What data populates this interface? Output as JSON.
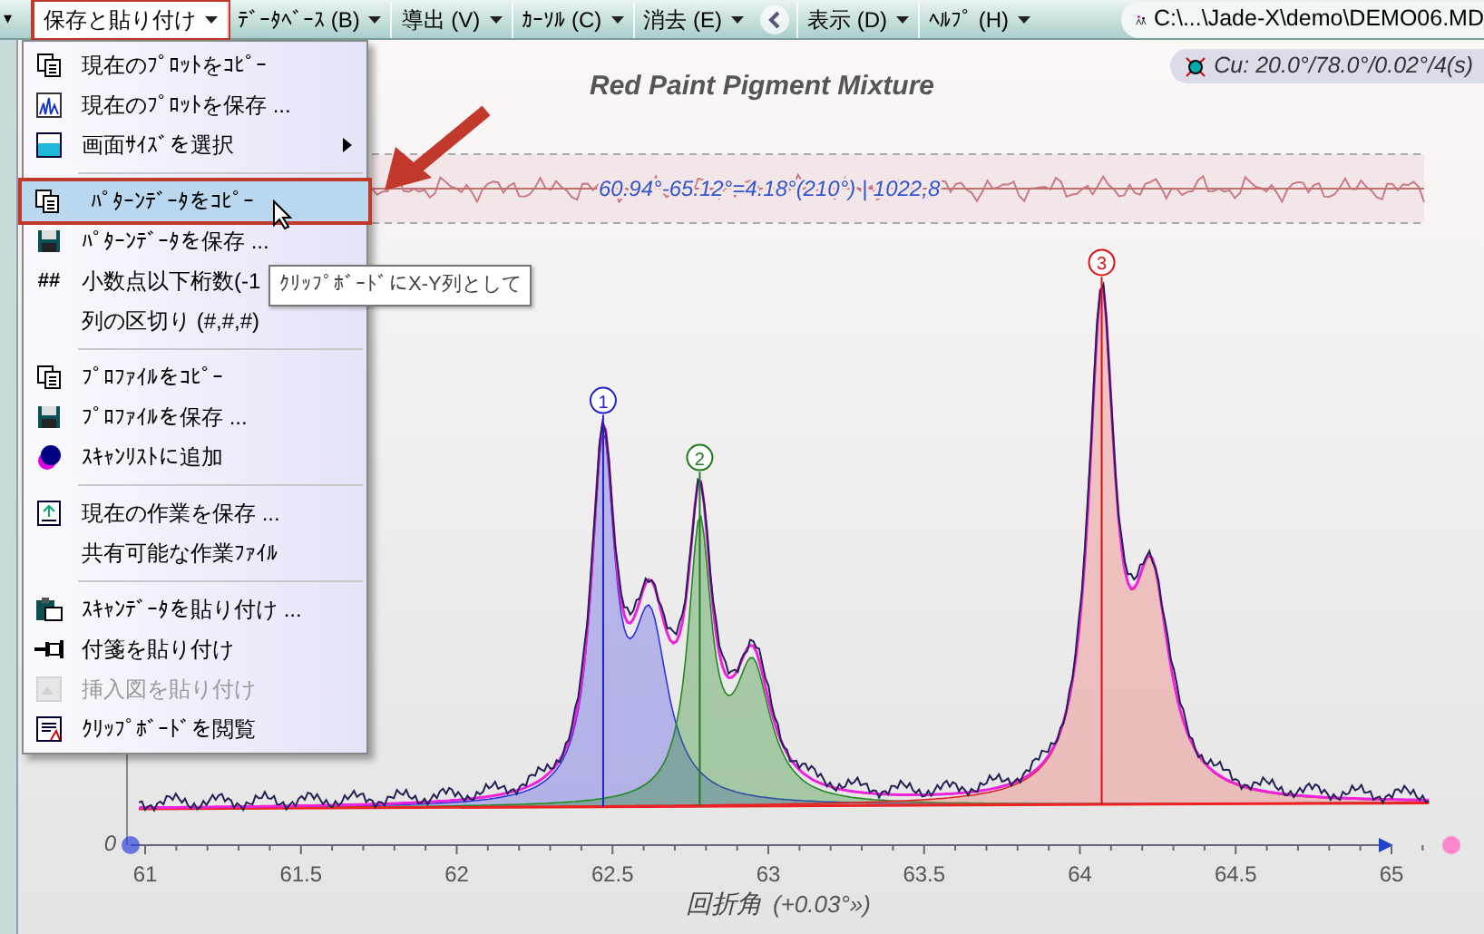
{
  "toolbar": {
    "lead_caret": "▾",
    "items": [
      {
        "label": "保存と貼り付け",
        "open": true
      },
      {
        "label": "ﾃﾞｰﾀﾍﾞｰｽ (B)",
        "open": false
      },
      {
        "label": "導出 (V)",
        "open": false
      },
      {
        "label": "ｶｰｿﾙ (C)",
        "open": false
      },
      {
        "label": "消去 (E)",
        "open": false
      },
      {
        "label": "表示 (D)",
        "open": false
      },
      {
        "label": "ﾍﾙﾌﾟ (H)",
        "open": false
      }
    ],
    "path": "C:\\...\\Jade-X\\demo\\DEMO06.MD",
    "source": "Cu: 20.0°/78.0°/0.02°/4(s)"
  },
  "menu": {
    "groups": [
      [
        {
          "label": "現在のﾌﾟﾛｯﾄをｺﾋﾟｰ",
          "selected": false,
          "disabled": false
        },
        {
          "label": "現在のﾌﾟﾛｯﾄを保存 ...",
          "selected": false,
          "disabled": false
        },
        {
          "label": "画面ｻｲｽﾞを選択",
          "selected": false,
          "disabled": false,
          "submenu": true
        }
      ],
      [
        {
          "label": "ﾊﾟﾀｰﾝﾃﾞｰﾀをｺﾋﾟｰ",
          "selected": true,
          "disabled": false
        },
        {
          "label": "ﾊﾟﾀｰﾝﾃﾞｰﾀを保存 ...",
          "selected": false,
          "disabled": false
        },
        {
          "label": "小数点以下桁数(-1",
          "glyph": "##",
          "selected": false,
          "disabled": false
        },
        {
          "label": "列の区切り (#,#,#)",
          "selected": false,
          "disabled": false
        }
      ],
      [
        {
          "label": "ﾌﾟﾛﾌｧｲﾙをｺﾋﾟｰ",
          "selected": false,
          "disabled": false
        },
        {
          "label": "ﾌﾟﾛﾌｧｲﾙを保存 ...",
          "selected": false,
          "disabled": false
        },
        {
          "label": "ｽｷｬﾝﾘｽﾄに追加",
          "selected": false,
          "disabled": false
        }
      ],
      [
        {
          "label": "現在の作業を保存 ...",
          "selected": false,
          "disabled": false
        },
        {
          "label": "共有可能な作業ﾌｧｲﾙ",
          "selected": false,
          "disabled": false
        }
      ],
      [
        {
          "label": "ｽｷｬﾝﾃﾞｰﾀを貼り付け ...",
          "selected": false,
          "disabled": false
        },
        {
          "label": "付箋を貼り付け",
          "selected": false,
          "disabled": false
        },
        {
          "label": "挿入図を貼り付け",
          "selected": false,
          "disabled": true
        },
        {
          "label": "ｸﾘｯﾌﾟﾎﾞｰﾄﾞを閲覧",
          "selected": false,
          "disabled": false
        }
      ]
    ]
  },
  "tooltip": "ｸﾘｯﾌﾟﾎﾞｰﾄﾞにX-Y列として",
  "plot": {
    "title": "Red Paint Pigment Mixture",
    "residual_label": "60.94°-65.12°=4.18°(210°) | 1022,8",
    "y_zero": "0",
    "xticks": [
      "61",
      "61.5",
      "62",
      "62.5",
      "63",
      "63.5",
      "64",
      "64.5",
      "65"
    ],
    "xlabel": "回折角",
    "offset": "(+0.03°»)",
    "peaks": [
      {
        "label": "1",
        "color": "#2222cc"
      },
      {
        "label": "2",
        "color": "#1e7a1e"
      },
      {
        "label": "3",
        "color": "#dd1111"
      }
    ]
  }
}
